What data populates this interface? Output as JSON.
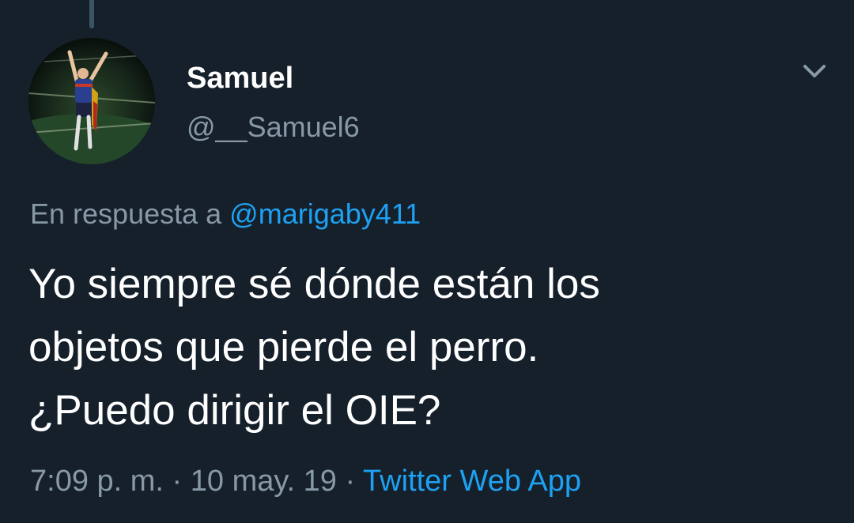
{
  "tweet": {
    "display_name": "Samuel",
    "handle": "@__Samuel6",
    "reply_prefix": "En respuesta a",
    "reply_mention": "@marigaby411",
    "text_lines": [
      "Yo siempre sé dónde están los",
      "objetos que pierde el perro.",
      "¿Puedo dirigir el OIE?"
    ],
    "time": "7:09 p. m.",
    "separator": "·",
    "date": "10 may. 19",
    "source": "Twitter Web App"
  },
  "icons": {
    "menu": "chevron-down-icon",
    "avatar": "profile-photo"
  },
  "colors": {
    "background": "#15202b",
    "primary_text": "#ffffff",
    "secondary_text": "#8899a6",
    "link": "#1da1f2"
  }
}
